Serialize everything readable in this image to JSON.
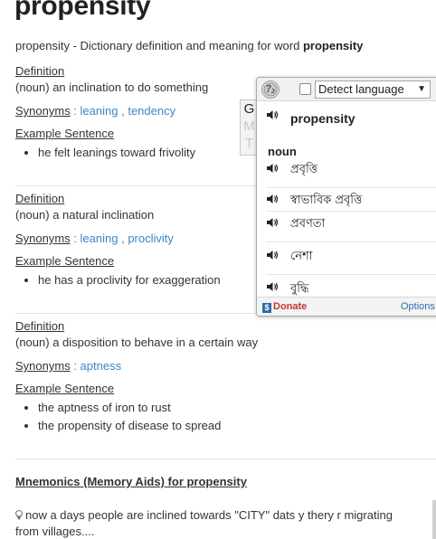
{
  "page": {
    "title": "propensity",
    "subtitle_prefix": "propensity - Dictionary definition and meaning for word ",
    "subtitle_word": "propensity",
    "definition_label": "Definition",
    "synonyms_label": "Synonyms",
    "synonyms_sep": " : ",
    "example_label": "Example Sentence"
  },
  "entries": [
    {
      "definition": "(noun) an inclination to do something",
      "synonyms": [
        "leaning",
        "tendency"
      ],
      "examples": [
        "he felt leanings toward frivolity"
      ]
    },
    {
      "definition": "(noun) a natural inclination",
      "synonyms": [
        "leaning",
        "proclivity"
      ],
      "examples": [
        "he has a proclivity for exaggeration"
      ]
    },
    {
      "definition": "(noun) a disposition to behave in a certain way",
      "synonyms": [
        "aptness"
      ],
      "examples": [
        "the aptness of iron to rust",
        "the propensity of disease to spread"
      ]
    }
  ],
  "mnemonics": {
    "title": "Mnemonics (Memory Aids) for propensity",
    "text": "now a days people are inclined towards \"CITY\" dats y thery r migrating from villages...."
  },
  "popup": {
    "lang_select": "Detect language",
    "gmt_letters": [
      "G",
      "M",
      "T"
    ],
    "head_word": "propensity",
    "part_of_speech": "noun",
    "translations": [
      "প্রবৃত্তি",
      "স্বাভাবিক প্রবৃত্তি",
      "প্রবণতা",
      "নেশা",
      "বুদ্ধি"
    ],
    "donate_label": "Donate",
    "options_label": "Options"
  },
  "colors": {
    "link": "#3a87c8",
    "donate": "#c0392b",
    "options": "#2a6fb4"
  },
  "icons": [
    "globe-icon",
    "speaker-icon",
    "dollar-icon",
    "lightbulb-icon",
    "dropdown-caret-icon"
  ]
}
